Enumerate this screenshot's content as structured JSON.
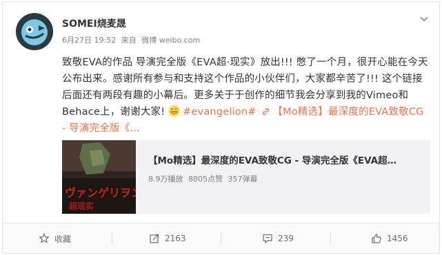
{
  "post": {
    "username": "SOMEI烧麦晟",
    "date": "6月27日 19:52",
    "source_prefix": "来自",
    "source": "微博 weibo.com",
    "text_main": "致敬EVA的作品 导演完全版《EVA超·现实》放出!!! 憋了一个月，很开心能在今天公布出来。感谢所有参与和支持这个作品的小伙伴们，大家都辛苦了!!! 这个链接后面还有两段有趣的小幕后。更多关于于创作的细节我会分享到我的Vimeo和Behace上，谢谢大家!",
    "hashtag": "#evangelion#",
    "link_text": "【Mo精选】最深度的EVA致敬CG - 导演完全版《...",
    "emoji_icon": "grin-emoji-icon"
  },
  "share_card": {
    "title": "【Mo精选】最深度的EVA致敬CG - 导演完全版《EVA超…",
    "plays": "8.9万播放",
    "likes": "8805点赞",
    "danmaku": "357弹幕"
  },
  "actions": {
    "favorite_label": "收藏",
    "repost_count": "2163",
    "comment_count": "239",
    "like_count": "1456"
  },
  "colors": {
    "accent": "#eb7350",
    "text": "#333333",
    "meta": "#808080"
  }
}
